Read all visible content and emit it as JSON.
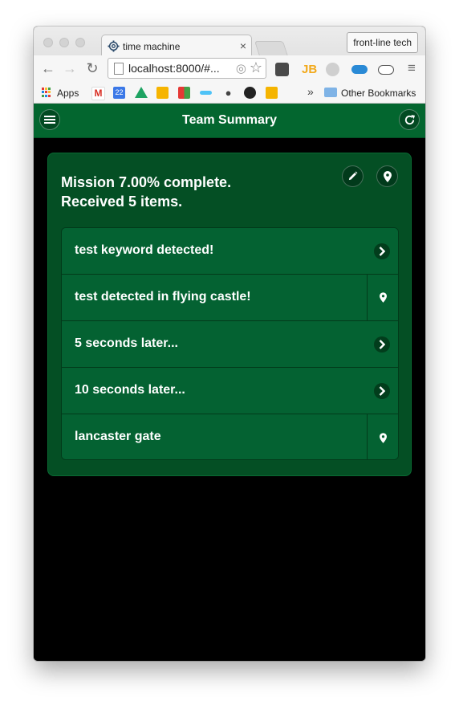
{
  "browser": {
    "tab_title": "time machine",
    "tab_close": "×",
    "profile_label": "front-line tech",
    "url": "localhost:8000/#...",
    "bookmarks": {
      "apps_label": "Apps",
      "overflow": "»",
      "other_label": "Other Bookmarks",
      "calendar_day": "22"
    }
  },
  "app": {
    "header_title": "Team Summary",
    "summary_line1": "Mission 7.00% complete.",
    "summary_line2": "Received 5 items.",
    "accent_color": "#03662f",
    "items": [
      {
        "label": "test keyword detected!",
        "action": "chevron-right-icon"
      },
      {
        "label": "test detected in flying castle!",
        "action": "map-pin-icon"
      },
      {
        "label": "5 seconds later...",
        "action": "chevron-right-icon"
      },
      {
        "label": "10 seconds later...",
        "action": "chevron-right-icon"
      },
      {
        "label": "lancaster gate",
        "action": "map-pin-icon"
      }
    ]
  }
}
